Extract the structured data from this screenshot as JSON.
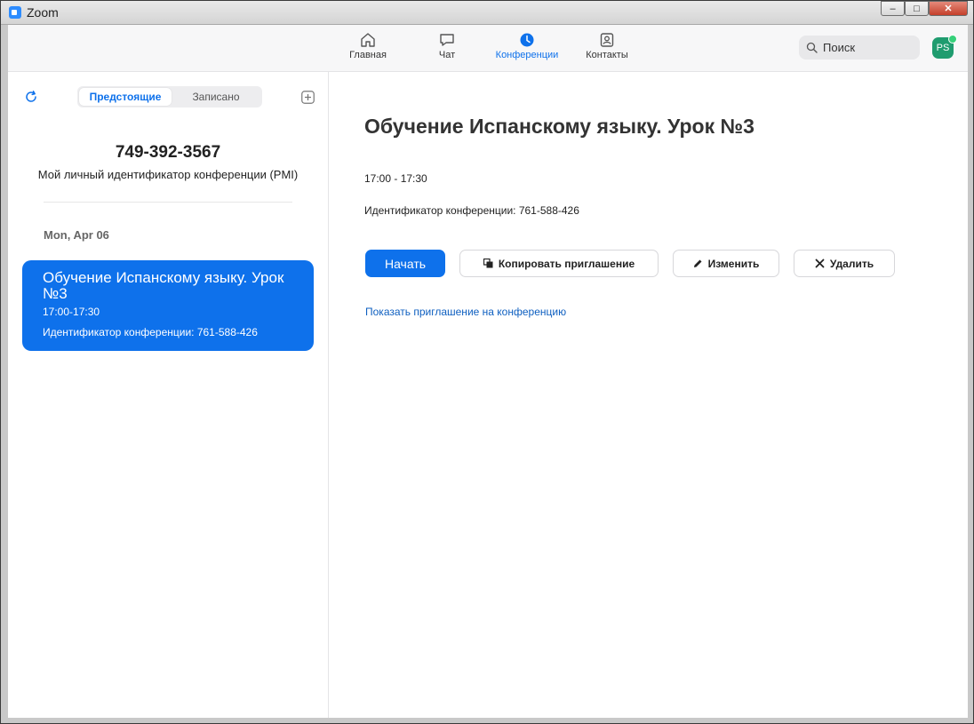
{
  "window": {
    "title": "Zoom",
    "controls": [
      "–",
      "□",
      "✕"
    ]
  },
  "nav": {
    "items": [
      {
        "label": "Главная",
        "icon": "home-icon"
      },
      {
        "label": "Чат",
        "icon": "chat-icon"
      },
      {
        "label": "Конференции",
        "icon": "clock-icon",
        "active": true
      },
      {
        "label": "Контакты",
        "icon": "contacts-icon"
      }
    ],
    "search_placeholder": "Поиск",
    "avatar_initials": "PS"
  },
  "sidebar": {
    "tabs": [
      {
        "label": "Предстоящие",
        "active": true
      },
      {
        "label": "Записано"
      }
    ],
    "pmi_number": "749-392-3567",
    "pmi_label": "Мой личный идентификатор конференции (PMI)",
    "date_header": "Mon, Apr 06",
    "meeting": {
      "title": "Обучение Испанскому языку. Урок №3",
      "time": "17:00-17:30",
      "id_line": "Идентификатор конференции: 761-588-426"
    }
  },
  "main": {
    "title": "Обучение Испанскому языку. Урок №3",
    "time": "17:00 - 17:30",
    "id_line": "Идентификатор конференции: 761-588-426",
    "buttons": {
      "start": "Начать",
      "copy": "Копировать приглашение",
      "edit": "Изменить",
      "delete": "Удалить"
    },
    "invite_link": "Показать приглашение на конференцию"
  },
  "colors": {
    "accent": "#0e71eb",
    "avatar": "#1f9c6f"
  }
}
